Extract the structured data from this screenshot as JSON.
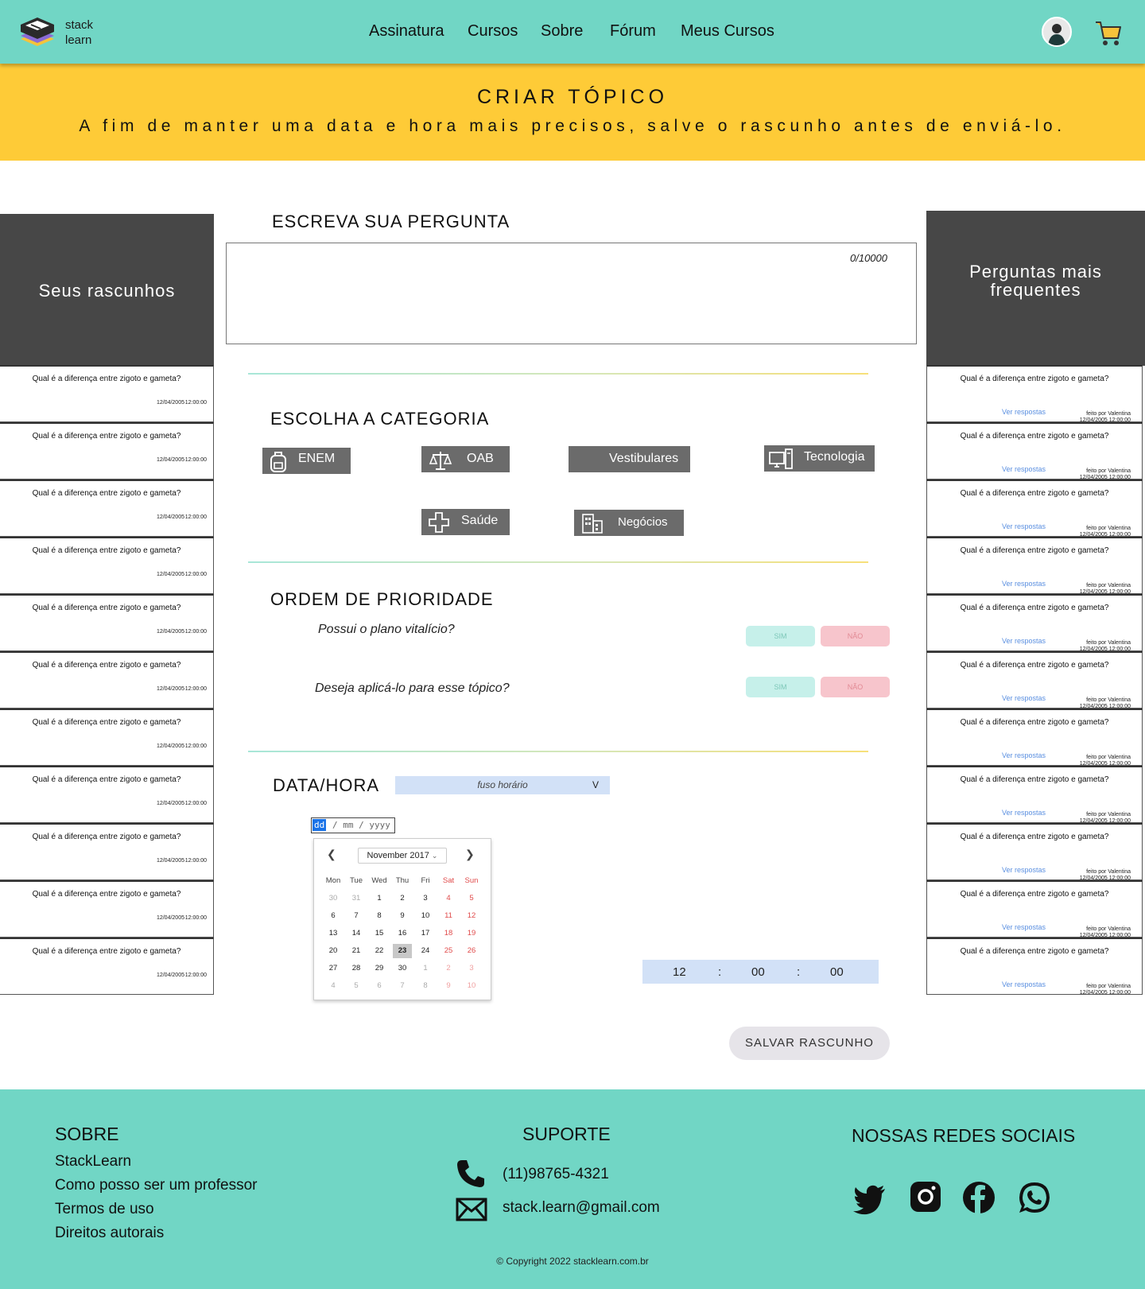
{
  "header": {
    "logo_text_1": "stack",
    "logo_text_2": "learn",
    "nav": [
      "Assinatura",
      "Cursos",
      "Sobre",
      "Fórum",
      "Meus Cursos"
    ],
    "avatar": "user-avatar",
    "cart_icon": "cart-icon"
  },
  "banner": {
    "title": "CRIAR TÓPICO",
    "subtitle": "A fim de manter uma data e hora mais precisos, salve o rascunho antes de enviá-lo."
  },
  "drafts": {
    "title": "Seus rascunhos",
    "items": [
      {
        "question": "Qual é a diferença entre zigoto e gameta?",
        "date": "12/04/2005",
        "time": "12:00:00"
      },
      {
        "question": "Qual é a diferença entre zigoto e gameta?",
        "date": "12/04/2005",
        "time": "12:00:00"
      },
      {
        "question": "Qual é a diferença entre zigoto e gameta?",
        "date": "12/04/2005",
        "time": "12:00:00"
      },
      {
        "question": "Qual é a diferença entre zigoto e gameta?",
        "date": "12/04/2005",
        "time": "12:00:00"
      },
      {
        "question": "Qual é a diferença entre zigoto e gameta?",
        "date": "12/04/2005",
        "time": "12:00:00"
      },
      {
        "question": "Qual é a diferença entre zigoto e gameta?",
        "date": "12/04/2005",
        "time": "12:00:00"
      },
      {
        "question": "Qual é a diferença entre zigoto e gameta?",
        "date": "12/04/2005",
        "time": "12:00:00"
      },
      {
        "question": "Qual é a diferença entre zigoto e gameta?",
        "date": "12/04/2005",
        "time": "12:00:00"
      },
      {
        "question": "Qual é a diferença entre zigoto e gameta?",
        "date": "12/04/2005",
        "time": "12:00:00"
      },
      {
        "question": "Qual é a diferença entre zigoto e gameta?",
        "date": "12/04/2005",
        "time": "12:00:00"
      },
      {
        "question": "Qual é a diferença entre zigoto e gameta?",
        "date": "12/04/2005",
        "time": "12:00:00"
      }
    ]
  },
  "faq": {
    "title": "Perguntas mais frequentes",
    "link_label": "Ver respostas",
    "by_label": "feito por Valentina",
    "date": "12/04/2005",
    "time": "12:00:00",
    "question": "Qual é a diferença entre zigoto e gameta?",
    "count": 11
  },
  "question": {
    "title": "ESCREVA SUA PERGUNTA",
    "counter": "0/10000"
  },
  "categories": {
    "title": "ESCOLHA A CATEGORIA",
    "items": [
      {
        "label": "ENEM",
        "icon": "backpack-icon"
      },
      {
        "label": "OAB",
        "icon": "scale-icon"
      },
      {
        "label": "Vestibulares",
        "icon": ""
      },
      {
        "label": "Tecnologia",
        "icon": "computer-icon"
      },
      {
        "label": "Saúde",
        "icon": "plus-cross-icon"
      },
      {
        "label": "Negócios",
        "icon": "building-icon"
      }
    ]
  },
  "priority": {
    "title": "ORDEM DE PRIORIDADE",
    "q1": "Possui o plano vitalício?",
    "q2": "Deseja aplicá-lo para esse tópico?",
    "yes": "SIM",
    "no": "NÃO"
  },
  "datetime": {
    "title": "DATA/HORA",
    "timezone_placeholder": "fuso horário",
    "date_dd": "dd",
    "date_rest": "/ mm / yyyy",
    "calendar": {
      "month": "November 2017",
      "weekdays": [
        "Mon",
        "Tue",
        "Wed",
        "Thu",
        "Fri",
        "Sat",
        "Sun"
      ],
      "weeks": [
        [
          "30",
          "31",
          "1",
          "2",
          "3",
          "4",
          "5"
        ],
        [
          "6",
          "7",
          "8",
          "9",
          "10",
          "11",
          "12"
        ],
        [
          "13",
          "14",
          "15",
          "16",
          "17",
          "18",
          "19"
        ],
        [
          "20",
          "21",
          "22",
          "23",
          "24",
          "25",
          "26"
        ],
        [
          "27",
          "28",
          "29",
          "30",
          "1",
          "2",
          "3"
        ],
        [
          "4",
          "5",
          "6",
          "7",
          "8",
          "9",
          "10"
        ]
      ],
      "selected": "23"
    },
    "time": {
      "hours": "12",
      "minutes": "00",
      "seconds": "00",
      "sep": ":"
    }
  },
  "save_button": "SALVAR RASCUNHO",
  "footer": {
    "about_title": "SOBRE",
    "about_links": [
      "StackLearn",
      "Como posso ser um professor",
      "Termos de uso",
      "Direitos autorais"
    ],
    "support_title": "SUPORTE",
    "phone": "(11)98765-4321",
    "email": "stack.learn@gmail.com",
    "social_title": "NOSSAS REDES SOCIAIS",
    "social": [
      "twitter-icon",
      "instagram-icon",
      "facebook-icon",
      "whatsapp-icon"
    ],
    "copyright": "© Copyright 2022 stacklearn.com.br"
  },
  "colors": {
    "header_bg": "#71d6c5",
    "banner_bg": "#fecb37",
    "side_head_bg": "#474747",
    "category_bg": "#6b6b6b",
    "yes_pill": "#c6f0ea",
    "no_pill": "#f7c5cc",
    "tz_bg": "#d2e1f7",
    "save_bg": "#e6e4e9"
  }
}
